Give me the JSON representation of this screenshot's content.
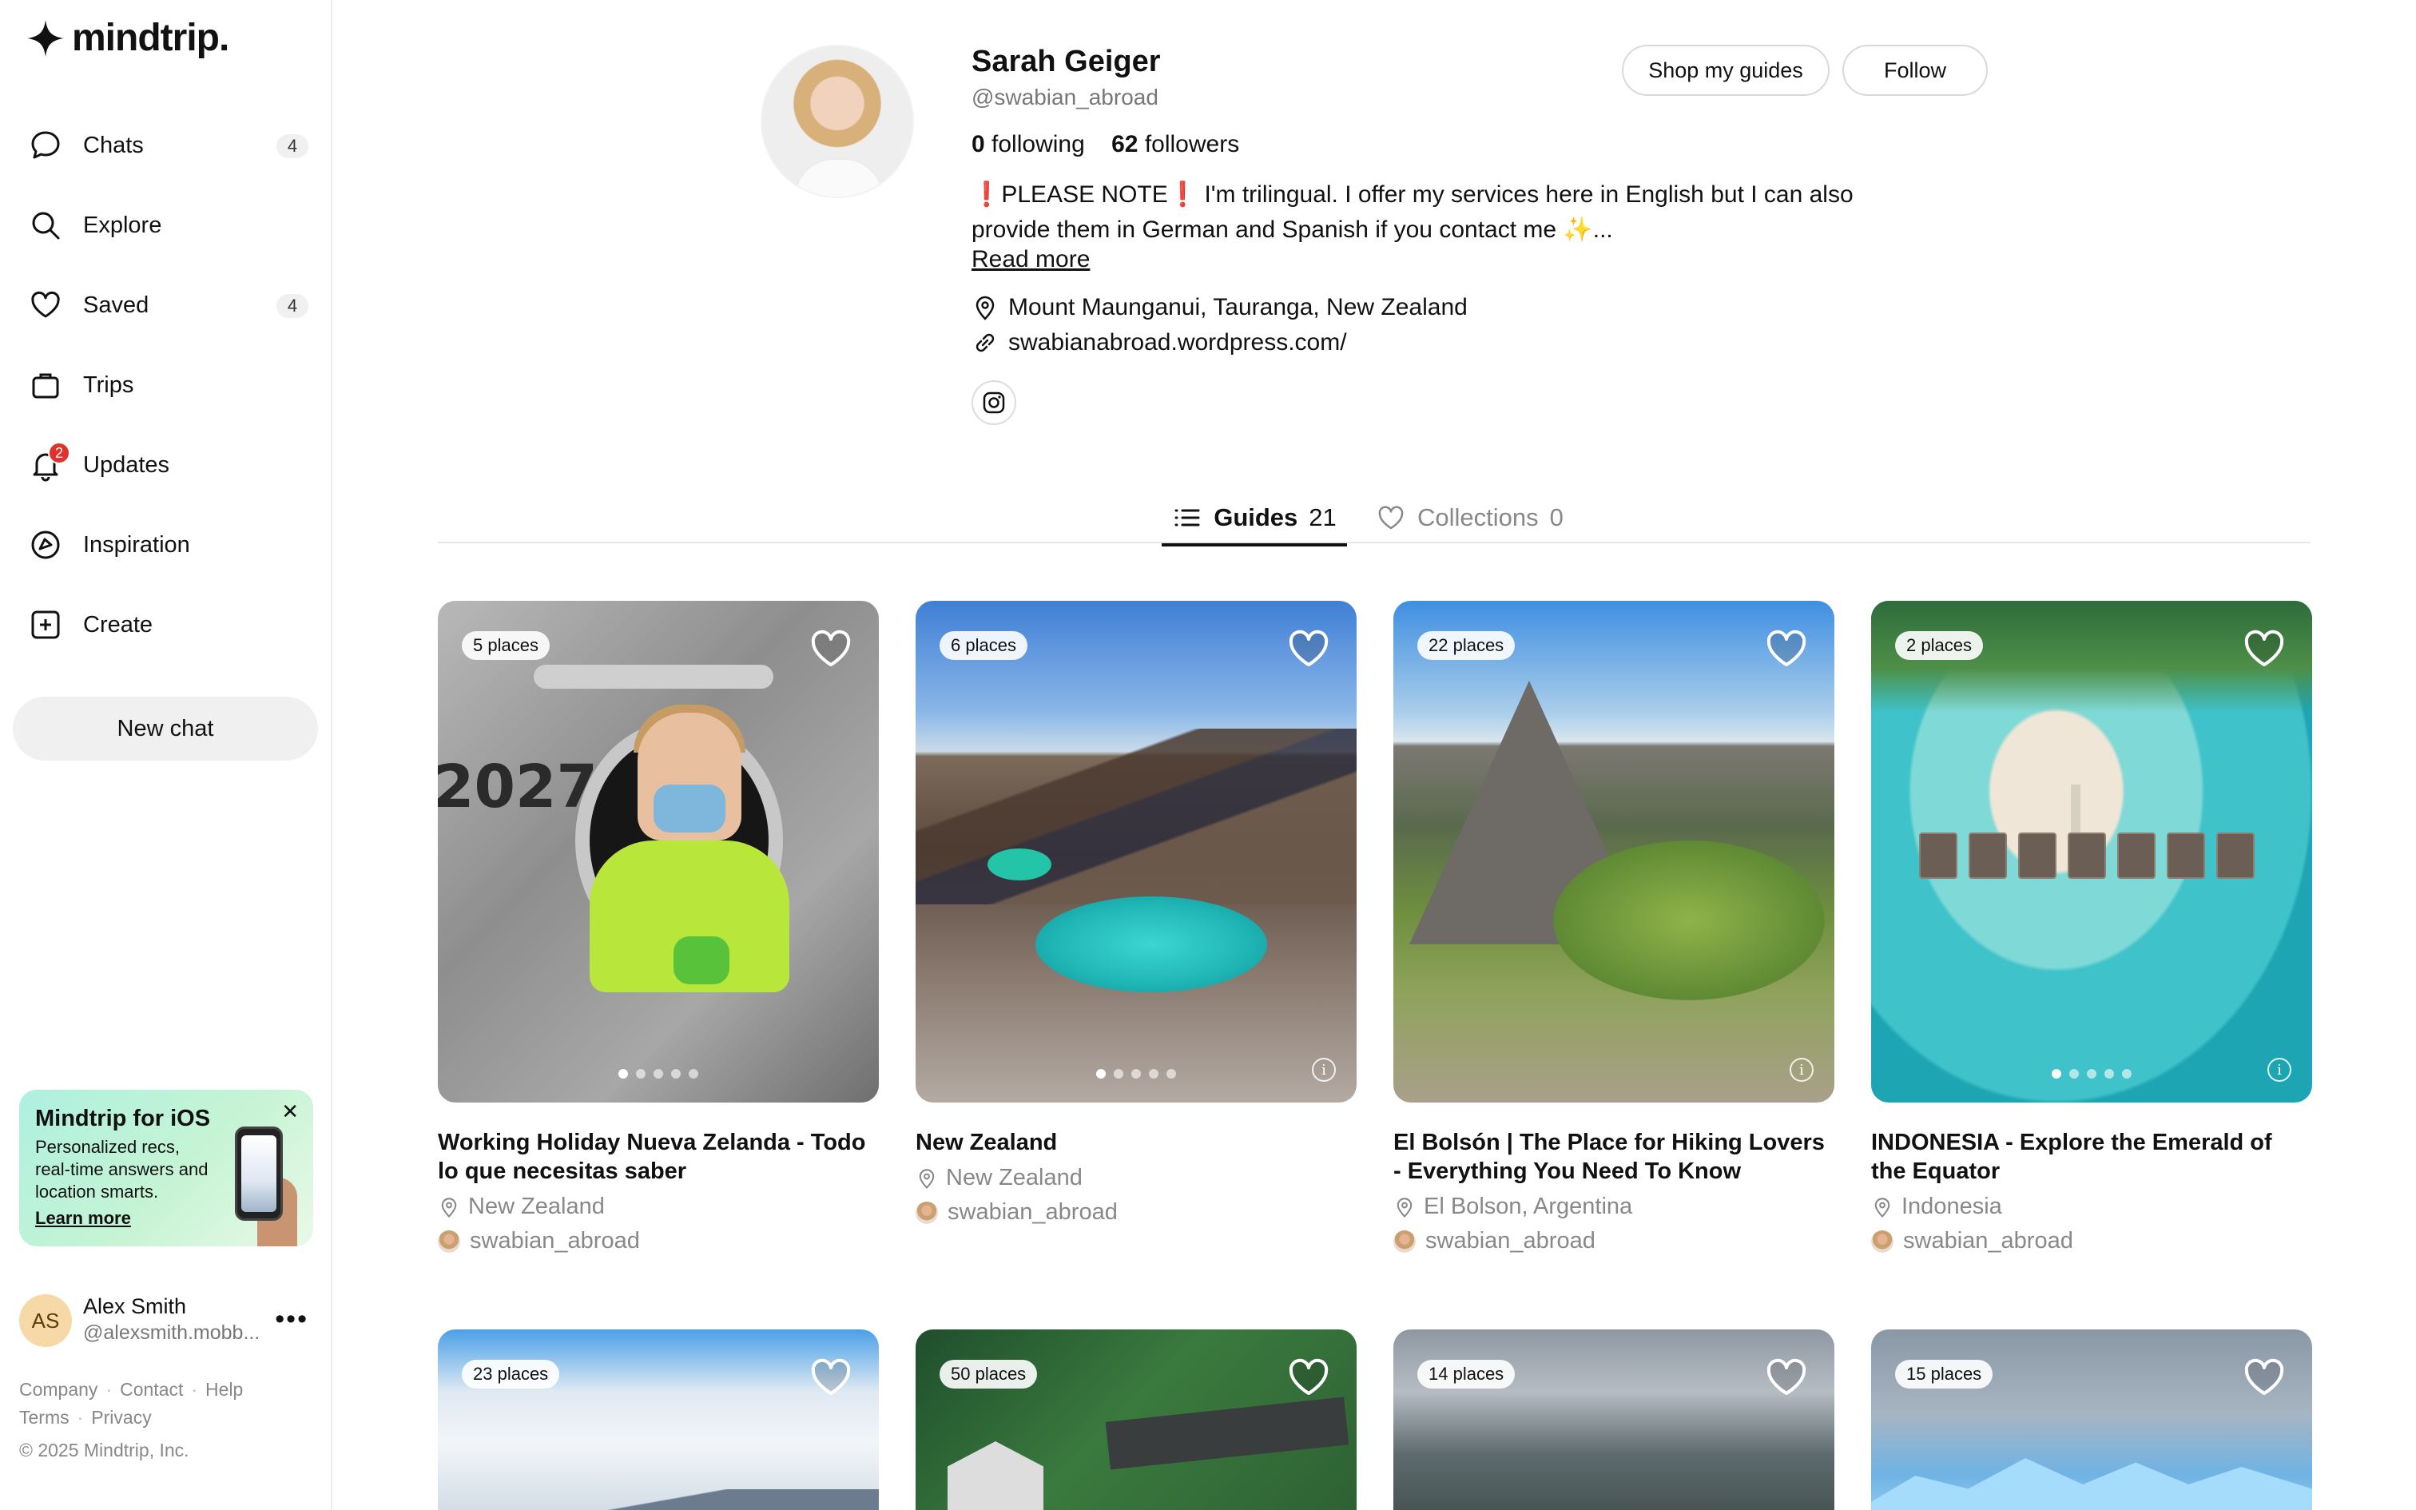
{
  "app": {
    "logo_text": "mindtrip.",
    "brand_color": "#111111"
  },
  "sidebar": {
    "items": [
      {
        "label": "Chats",
        "icon": "chat-bubble-icon",
        "count": "4"
      },
      {
        "label": "Explore",
        "icon": "search-icon"
      },
      {
        "label": "Saved",
        "icon": "heart-icon",
        "count": "4"
      },
      {
        "label": "Trips",
        "icon": "suitcase-icon"
      },
      {
        "label": "Updates",
        "icon": "bell-icon",
        "badge": "2"
      },
      {
        "label": "Inspiration",
        "icon": "compass-icon"
      },
      {
        "label": "Create",
        "icon": "plus-square-icon"
      }
    ],
    "new_chat_label": "New chat",
    "promo": {
      "title": "Mindtrip for iOS",
      "description": "Personalized recs, real-time answers and location smarts.",
      "link": "Learn more",
      "close": "✕"
    },
    "user": {
      "initials": "AS",
      "name": "Alex Smith",
      "handle": "@alexsmith.mobb..."
    },
    "footer": {
      "company": "Company",
      "contact": "Contact",
      "help": "Help",
      "terms": "Terms",
      "privacy": "Privacy",
      "copyright": "© 2025 Mindtrip, Inc."
    }
  },
  "profile": {
    "name": "Sarah Geiger",
    "handle": "@swabian_abroad",
    "following_count": "0",
    "following_label": "following",
    "followers_count": "62",
    "followers_label": "followers",
    "bio": "❗PLEASE NOTE❗ I'm trilingual. I offer my services here in English but I can also provide them in German and Spanish if you contact me ✨...",
    "read_more": "Read more",
    "location": "Mount Maunganui, Tauranga, New Zealand",
    "website": "swabianabroad.wordpress.com/",
    "shop_label": "Shop my guides",
    "follow_label": "Follow"
  },
  "tabs": {
    "guides_label": "Guides",
    "guides_count": "21",
    "collections_label": "Collections",
    "collections_count": "0"
  },
  "guides": [
    {
      "places": "5 places",
      "title": "Working Holiday Nueva Zelanda - Todo lo que necesitas saber",
      "location": "New Zealand",
      "author": "swabian_abroad",
      "dots": 5,
      "active_dot": 0
    },
    {
      "places": "6 places",
      "title": "New Zealand",
      "location": "New Zealand",
      "author": "swabian_abroad",
      "dots": 5,
      "active_dot": 0
    },
    {
      "places": "22 places",
      "title": "El Bolsón | The Place for Hiking Lovers - Everything You Need To Know",
      "location": "El Bolson, Argentina",
      "author": "swabian_abroad",
      "dots": 0,
      "active_dot": 0
    },
    {
      "places": "2 places",
      "title": "INDONESIA - Explore the Emerald of the Equator",
      "location": "Indonesia",
      "author": "swabian_abroad",
      "dots": 5,
      "active_dot": 0
    },
    {
      "places": "23 places"
    },
    {
      "places": "50 places"
    },
    {
      "places": "14 places"
    },
    {
      "places": "15 places"
    }
  ]
}
